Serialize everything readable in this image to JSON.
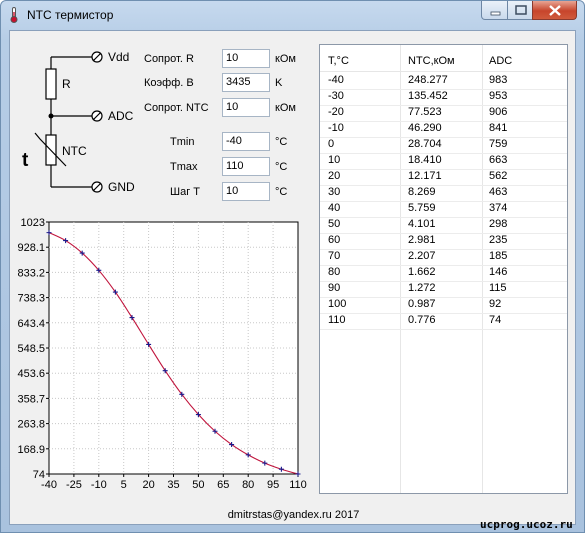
{
  "window": {
    "title": "NTC термистор"
  },
  "circuit": {
    "vdd": "Vdd",
    "adc": "ADC",
    "gnd": "GND",
    "r_label": "R",
    "ntc_label": "NTC",
    "t_label": "t"
  },
  "params": {
    "r": {
      "label": "Сопрот. R",
      "value": "10",
      "unit": "кОм"
    },
    "b": {
      "label": "Коэфф. B",
      "value": "3435",
      "unit": "K"
    },
    "ntc": {
      "label": "Сопрот. NTC",
      "value": "10",
      "unit": "кОм"
    },
    "tmin": {
      "label": "Tmin",
      "value": "-40",
      "unit": "°C"
    },
    "tmax": {
      "label": "Tmax",
      "value": "110",
      "unit": "°C"
    },
    "step": {
      "label": "Шаг T",
      "value": "10",
      "unit": "°C"
    }
  },
  "table": {
    "headers": [
      "T,°C",
      "NTC,кОм",
      "ADC"
    ],
    "rows": [
      [
        "-40",
        "248.277",
        "983"
      ],
      [
        "-30",
        "135.452",
        "953"
      ],
      [
        "-20",
        "77.523",
        "906"
      ],
      [
        "-10",
        "46.290",
        "841"
      ],
      [
        "0",
        "28.704",
        "759"
      ],
      [
        "10",
        "18.410",
        "663"
      ],
      [
        "20",
        "12.171",
        "562"
      ],
      [
        "30",
        "8.269",
        "463"
      ],
      [
        "40",
        "5.759",
        "374"
      ],
      [
        "50",
        "4.101",
        "298"
      ],
      [
        "60",
        "2.981",
        "235"
      ],
      [
        "70",
        "2.207",
        "185"
      ],
      [
        "80",
        "1.662",
        "146"
      ],
      [
        "90",
        "1.272",
        "115"
      ],
      [
        "100",
        "0.987",
        "92"
      ],
      [
        "110",
        "0.776",
        "74"
      ]
    ]
  },
  "chart_data": {
    "type": "line",
    "x": [
      -40,
      -30,
      -20,
      -10,
      0,
      10,
      20,
      30,
      40,
      50,
      60,
      70,
      80,
      90,
      100,
      110
    ],
    "series": [
      {
        "values": [
          983,
          953,
          906,
          841,
          759,
          663,
          562,
          463,
          374,
          298,
          235,
          185,
          146,
          115,
          92,
          74
        ]
      }
    ],
    "xticks": [
      "-40",
      "-25",
      "-10",
      "5",
      "20",
      "35",
      "50",
      "65",
      "80",
      "95",
      "110"
    ],
    "yticks": [
      "1023",
      "928.1",
      "833.2",
      "738.3",
      "643.4",
      "548.5",
      "453.6",
      "358.7",
      "263.8",
      "168.9",
      "74"
    ],
    "xlim": [
      -40,
      110
    ],
    "ylim": [
      74,
      1023
    ],
    "grid": true,
    "line_color": "#c0143c",
    "marker_color": "#1a1a8c",
    "title": "",
    "xlabel": "",
    "ylabel": ""
  },
  "footer": {
    "text": "dmitrstas@yandex.ru  2017"
  },
  "watermark": "ucprog.ucoz.ru"
}
